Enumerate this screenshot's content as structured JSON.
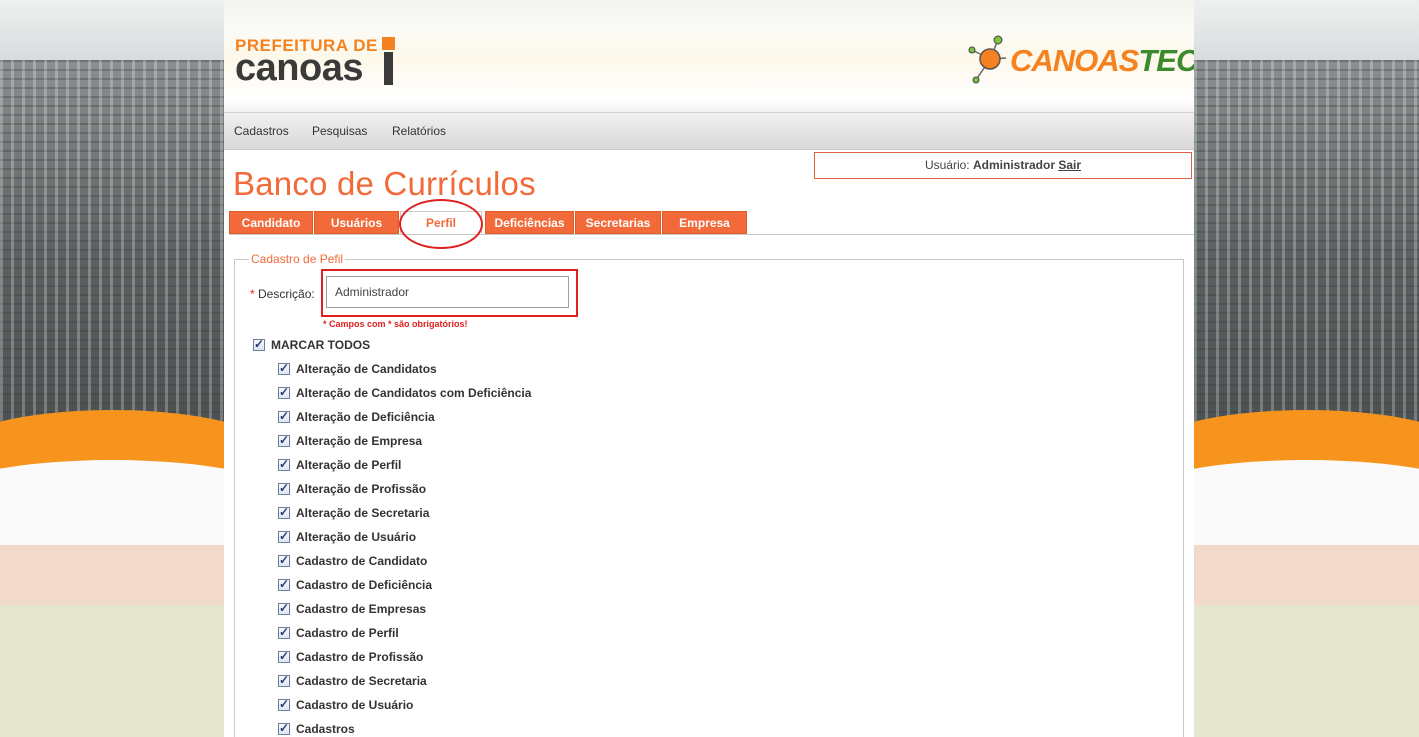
{
  "header": {
    "logo_line1": "PREFEITURA DE",
    "logo_line2": "canoas",
    "tec_logo_part1": "CANOAS",
    "tec_logo_part2": "TEC"
  },
  "nav": {
    "items": [
      "Cadastros",
      "Pesquisas",
      "Relatórios"
    ]
  },
  "user_box": {
    "label": "Usuário:",
    "name": "Administrador",
    "logout": "Sair"
  },
  "page_title": "Banco de Currículos",
  "tabs": [
    {
      "label": "Candidato",
      "active": false
    },
    {
      "label": "Usuários",
      "active": false
    },
    {
      "label": "Perfil",
      "active": true
    },
    {
      "label": "Deficiências",
      "active": false
    },
    {
      "label": "Secretarias",
      "active": false
    },
    {
      "label": "Empresa",
      "active": false
    }
  ],
  "form": {
    "legend": "Cadastro de Pefil",
    "descricao_required_mark": "*",
    "descricao_label": "Descrição:",
    "descricao_value": "Administrador",
    "required_note": "* Campos com * são obrigatórios!",
    "select_all_label": "MARCAR TODOS",
    "permissions": [
      "Alteração de Candidatos",
      "Alteração de Candidatos com Deficiência",
      "Alteração de Deficiência",
      "Alteração de Empresa",
      "Alteração de Perfil",
      "Alteração de Profissão",
      "Alteração de Secretaria",
      "Alteração de Usuário",
      "Cadastro de Candidato",
      "Cadastro de Deficiência",
      "Cadastro de Empresas",
      "Cadastro de Perfil",
      "Cadastro de Profissão",
      "Cadastro de Secretaria",
      "Cadastro de Usuário",
      "Cadastros"
    ]
  },
  "colors": {
    "accent": "#f26a39",
    "highlight": "#e02020"
  }
}
